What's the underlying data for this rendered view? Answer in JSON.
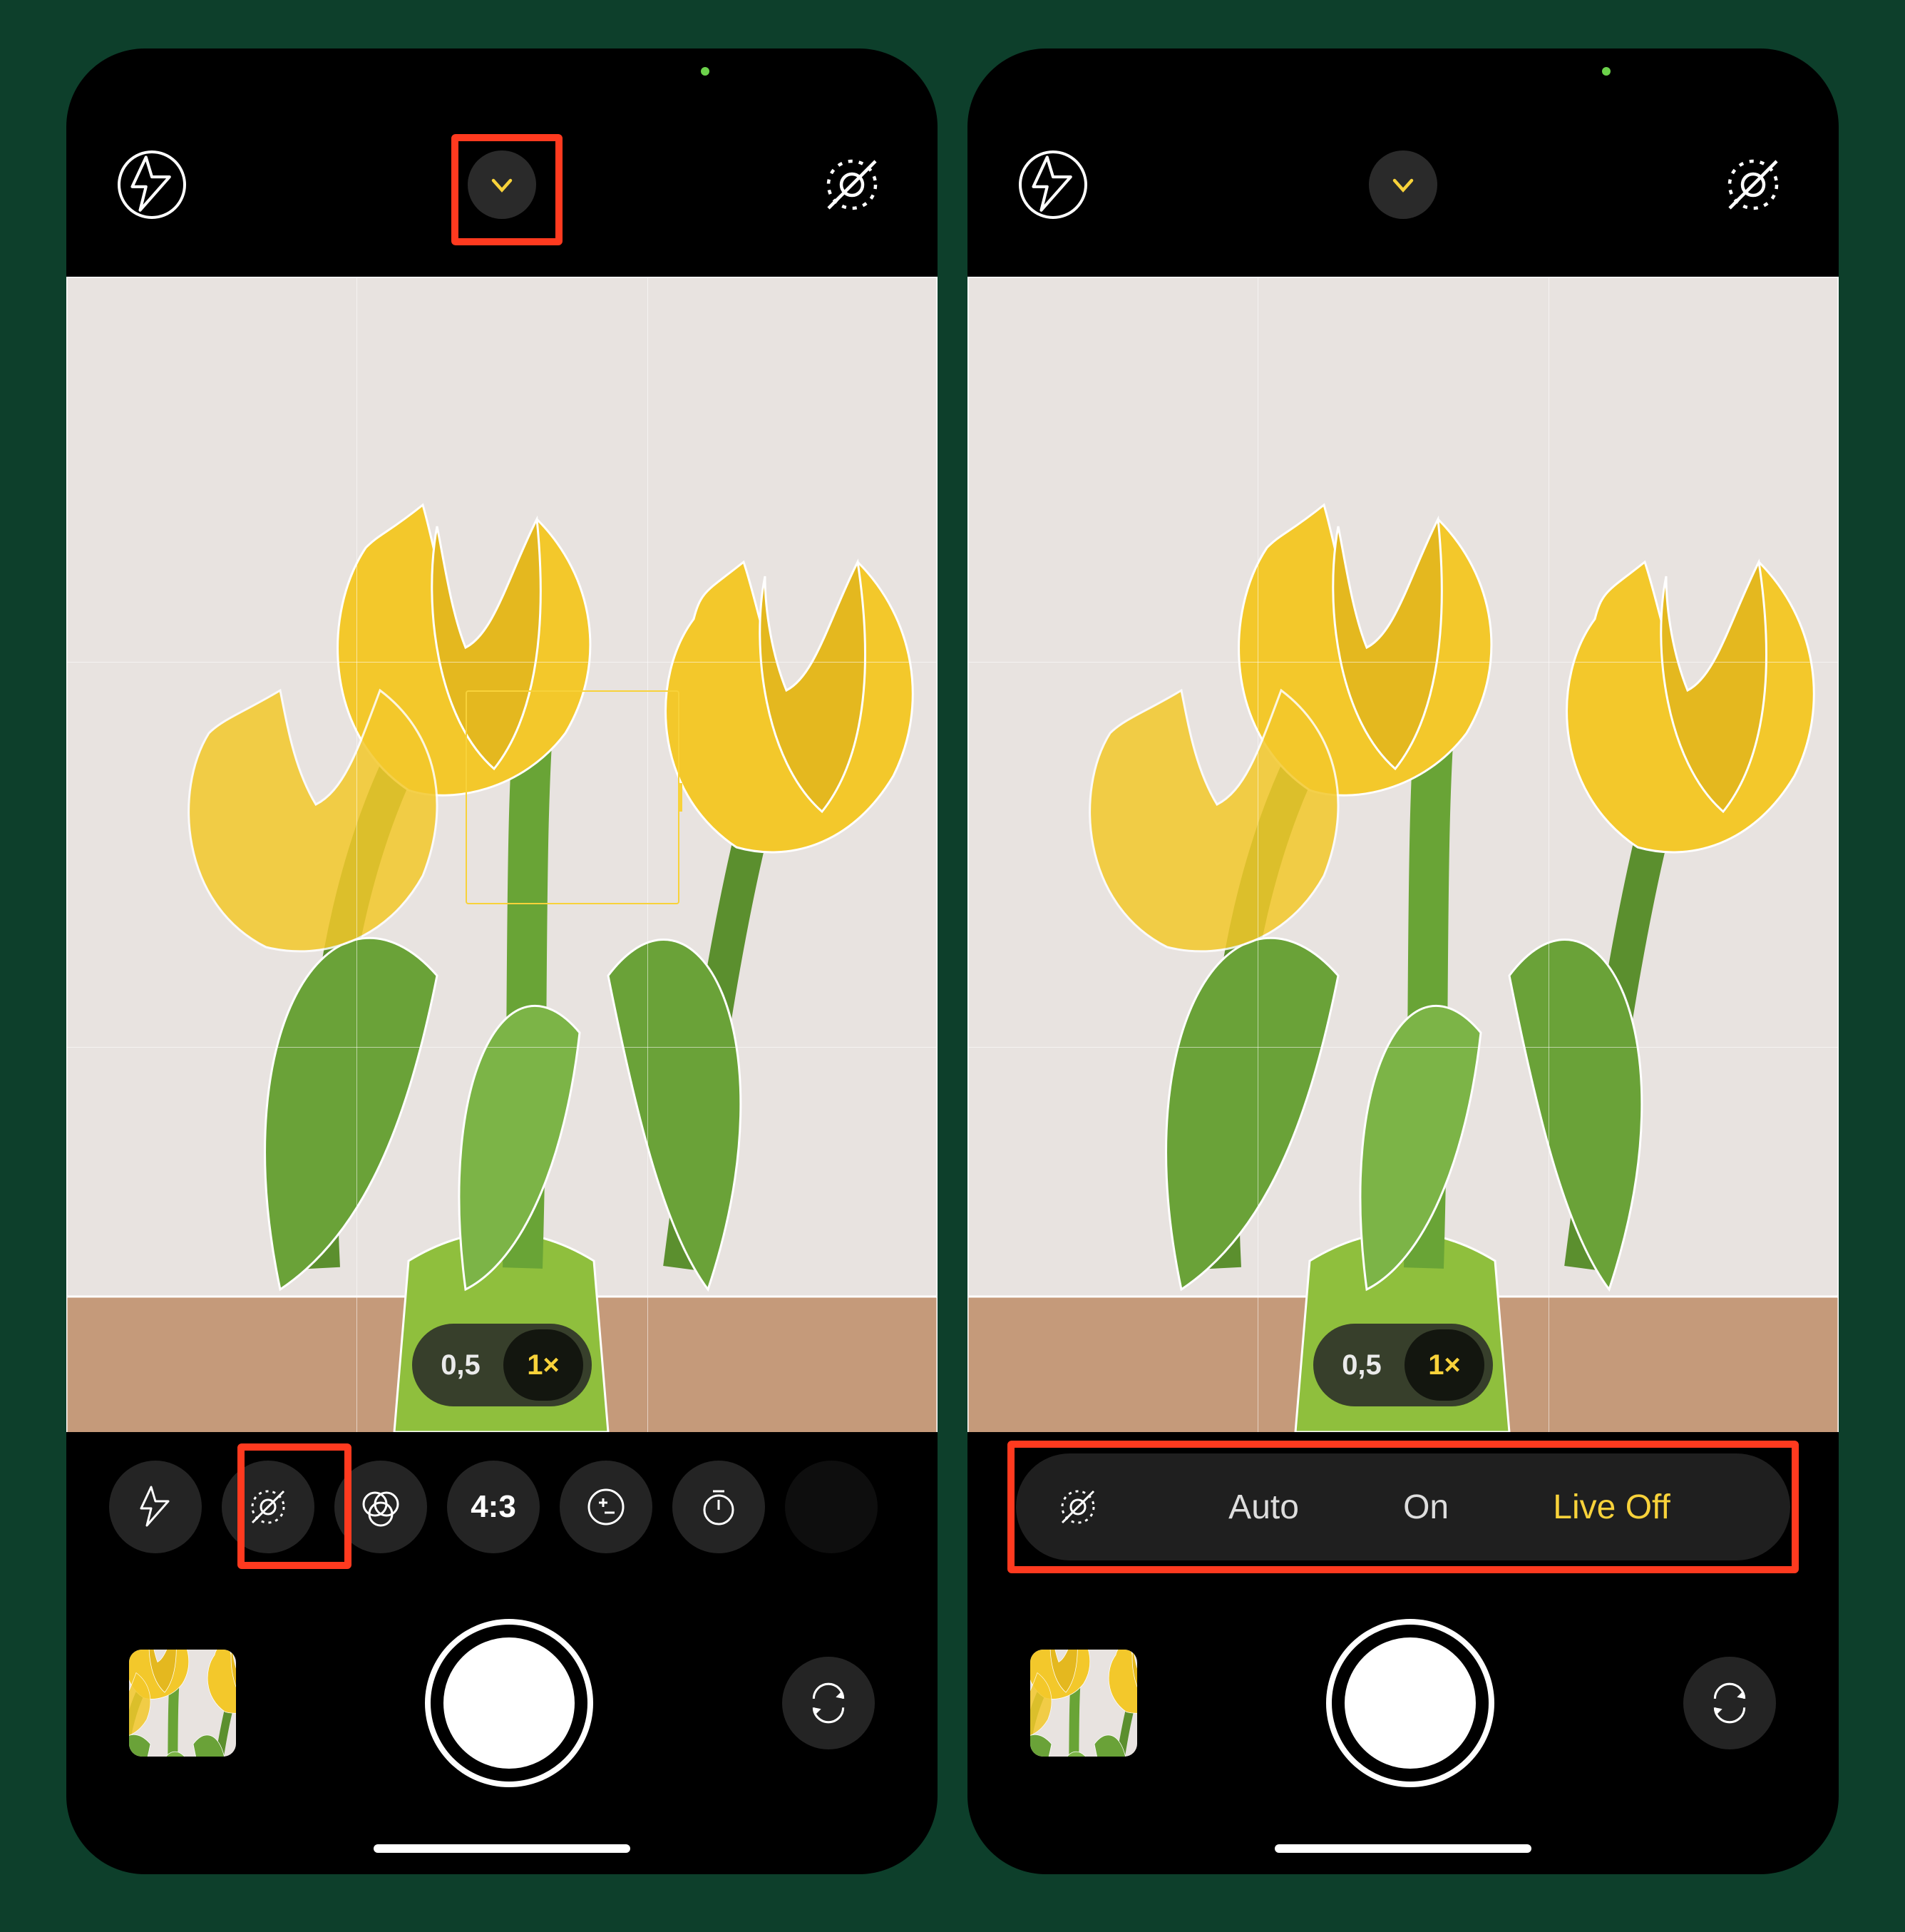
{
  "zoom": {
    "wide": "0,5",
    "main": "1×"
  },
  "options": {
    "aspect": "4:3"
  },
  "live_photo": {
    "auto": "Auto",
    "on": "On",
    "off": "Live Off",
    "selected": "off"
  },
  "icons": {
    "flash": "flash-icon",
    "live": "live-photo-icon",
    "filters": "filters-icon",
    "exposure": "exposure-icon",
    "timer": "timer-icon",
    "flip": "camera-flip-icon",
    "chevron": "chevron-down-icon"
  },
  "annotations": {
    "left_top": "highlight on chevron toggle",
    "left_mid": "highlight on Live Photo option button",
    "right_strip": "highlight on Live Photo Auto/On/Off strip"
  }
}
